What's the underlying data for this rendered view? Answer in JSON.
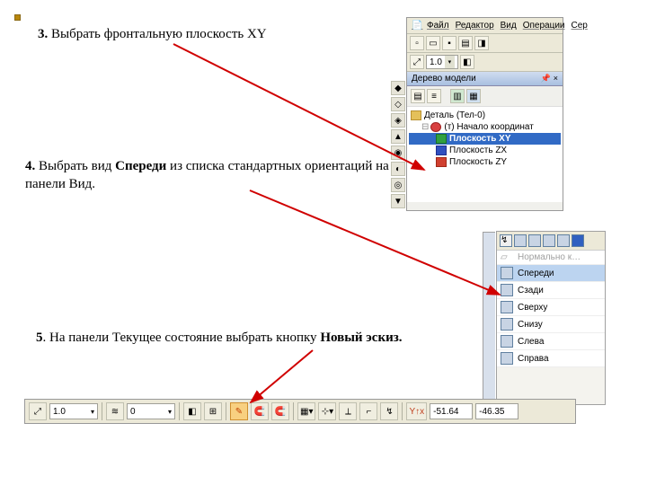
{
  "steps": {
    "s3_num": "3.",
    "s3_text": " Выбрать фронтальную плоскость XY",
    "s4_num": "4.",
    "s4_text_a": " Выбрать вид ",
    "s4_bold": "Спереди",
    "s4_text_b": " из списка стандартных ориентаций на панели Вид.",
    "s5_num": "5",
    "s5_text": ". На панели Текущее состояние выбрать кнопку ",
    "s5_bold": "Новый эскиз."
  },
  "shot1": {
    "menu": {
      "file": "Файл",
      "edit": "Редактор",
      "view": "Вид",
      "ops": "Операции",
      "serv": "Сер"
    },
    "zoom": "1.0",
    "panel_title": "Дерево модели",
    "pin": "□ ×",
    "tree": {
      "root": "Деталь (Тел-0)",
      "origin": "(т) Начало координат",
      "p_xy": "Плоскость XY",
      "p_zx": "Плоскость ZX",
      "p_zy": "Плоскость ZY"
    },
    "plane_colors": {
      "xy": "#30a040",
      "zx": "#3050c0",
      "zy": "#d04030"
    }
  },
  "shot2": {
    "normal": "Нормально к…",
    "items": {
      "front": "Спереди",
      "back": "Сзади",
      "top": "Сверху",
      "bottom": "Снизу",
      "left": "Слева",
      "right": "Справа"
    }
  },
  "shot3": {
    "zoom": "1.0",
    "layer": "0",
    "x": "-51.64",
    "y": "-46.35"
  }
}
